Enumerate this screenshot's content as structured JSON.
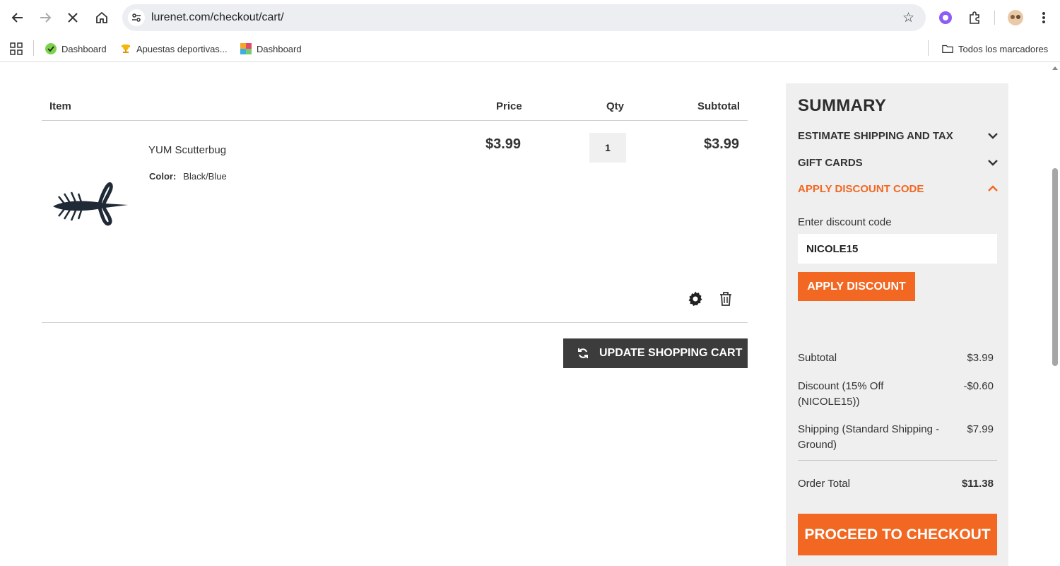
{
  "browser": {
    "url": "lurenet.com/checkout/cart/",
    "bookmarks": [
      {
        "label": "Dashboard",
        "icon": "green-logo-icon"
      },
      {
        "label": "Apuestas deportivas...",
        "icon": "trophy-icon"
      },
      {
        "label": "Dashboard",
        "icon": "colorful-grid-icon"
      }
    ],
    "all_bookmarks_label": "Todos los marcadores"
  },
  "cart": {
    "headers": {
      "item": "Item",
      "price": "Price",
      "qty": "Qty",
      "subtotal": "Subtotal"
    },
    "items": [
      {
        "name": "YUM Scutterbug",
        "option_label": "Color:",
        "option_value": "Black/Blue",
        "price": "$3.99",
        "qty": "1",
        "subtotal": "$3.99"
      }
    ],
    "update_button": "UPDATE SHOPPING CART"
  },
  "summary": {
    "title": "SUMMARY",
    "sections": {
      "shipping": "ESTIMATE SHIPPING AND TAX",
      "gift": "GIFT CARDS",
      "discount": "APPLY DISCOUNT CODE"
    },
    "discount_label": "Enter discount code",
    "discount_value": "NICOLE15",
    "apply_button": "APPLY DISCOUNT",
    "totals": {
      "subtotal_label": "Subtotal",
      "subtotal_value": "$3.99",
      "discount_label": "Discount (15% Off (NICOLE15))",
      "discount_value": "-$0.60",
      "shipping_label": "Shipping (Standard Shipping - Ground)",
      "shipping_value": "$7.99",
      "order_total_label": "Order Total",
      "order_total_value": "$11.38"
    },
    "checkout_button": "PROCEED TO CHECKOUT"
  },
  "colors": {
    "accent": "#f26722",
    "dark_button": "#3c3c3d",
    "summary_bg": "#efefef"
  }
}
